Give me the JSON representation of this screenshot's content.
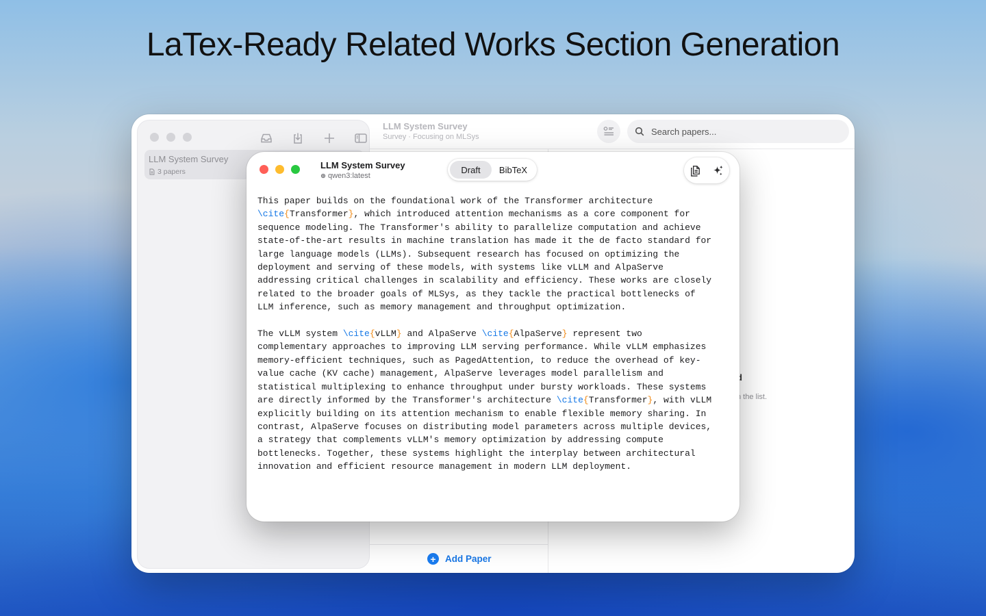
{
  "headline": "LaTex-Ready Related Works Section Generation",
  "back_window": {
    "sidebar": {
      "collection": {
        "name": "LLM System Survey",
        "count": "3 papers"
      }
    },
    "header": {
      "title": "LLM System Survey",
      "subtitle": "Survey · Focusing on MLSys"
    },
    "search": {
      "placeholder": "Search papers..."
    },
    "add_paper_label": "Add Paper",
    "detail_hint": "n the list."
  },
  "front_window": {
    "title": "LLM System Survey",
    "model": "qwen3:latest",
    "tabs": [
      {
        "label": "Draft",
        "active": true
      },
      {
        "label": "BibTeX",
        "active": false
      }
    ],
    "draft_lines": [
      [
        [
          "t",
          "This paper builds on the foundational work of the Transformer architecture"
        ]
      ],
      [
        [
          "c",
          "\\cite"
        ],
        [
          "b",
          "{"
        ],
        [
          "t",
          "Transformer"
        ],
        [
          "b",
          "}"
        ],
        [
          "t",
          ", which introduced attention mechanisms as a core component for"
        ]
      ],
      [
        [
          "t",
          "sequence modeling. The Transformer's ability to parallelize computation and achieve"
        ]
      ],
      [
        [
          "t",
          "state-of-the-art results in machine translation has made it the de facto standard for"
        ]
      ],
      [
        [
          "t",
          "large language models (LLMs). Subsequent research has focused on optimizing the"
        ]
      ],
      [
        [
          "t",
          "deployment and serving of these models, with systems like vLLM and AlpaServe"
        ]
      ],
      [
        [
          "t",
          "addressing critical challenges in scalability and efficiency. These works are closely"
        ]
      ],
      [
        [
          "t",
          "related to the broader goals of MLSys, as they tackle the practical bottlenecks of"
        ]
      ],
      [
        [
          "t",
          "LLM inference, such as memory management and throughput optimization."
        ]
      ],
      [],
      [
        [
          "t",
          "The vLLM system "
        ],
        [
          "c",
          "\\cite"
        ],
        [
          "b",
          "{"
        ],
        [
          "t",
          "vLLM"
        ],
        [
          "b",
          "}"
        ],
        [
          "t",
          " and AlpaServe "
        ],
        [
          "c",
          "\\cite"
        ],
        [
          "b",
          "{"
        ],
        [
          "t",
          "AlpaServe"
        ],
        [
          "b",
          "}"
        ],
        [
          "t",
          " represent two"
        ]
      ],
      [
        [
          "t",
          "complementary approaches to improving LLM serving performance. While vLLM emphasizes"
        ]
      ],
      [
        [
          "t",
          "memory-efficient techniques, such as PagedAttention, to reduce the overhead of key-"
        ]
      ],
      [
        [
          "t",
          "value cache (KV cache) management, AlpaServe leverages model parallelism and"
        ]
      ],
      [
        [
          "t",
          "statistical multiplexing to enhance throughput under bursty workloads. These systems"
        ]
      ],
      [
        [
          "t",
          "are directly informed by the Transformer's architecture "
        ],
        [
          "c",
          "\\cite"
        ],
        [
          "b",
          "{"
        ],
        [
          "t",
          "Transformer"
        ],
        [
          "b",
          "}"
        ],
        [
          "t",
          ", with vLLM"
        ]
      ],
      [
        [
          "t",
          "explicitly building on its attention mechanism to enable flexible memory sharing. In"
        ]
      ],
      [
        [
          "t",
          "contrast, AlpaServe focuses on distributing model parameters across multiple devices,"
        ]
      ],
      [
        [
          "t",
          "a strategy that complements vLLM's memory optimization by addressing compute"
        ]
      ],
      [
        [
          "t",
          "bottlenecks. Together, these systems highlight the interplay between architectural"
        ]
      ],
      [
        [
          "t",
          "innovation and efficient resource management in modern LLM deployment."
        ]
      ]
    ]
  },
  "colors": {
    "cite_command": "#1477e6",
    "cite_brace": "#f08a16",
    "accent": "#1a7cf0"
  },
  "icons": {
    "toolbar": [
      "tray-icon",
      "download-icon",
      "plus-icon",
      "sidebar-icon"
    ],
    "actions": [
      "copy-icon",
      "sparkles-icon"
    ]
  }
}
